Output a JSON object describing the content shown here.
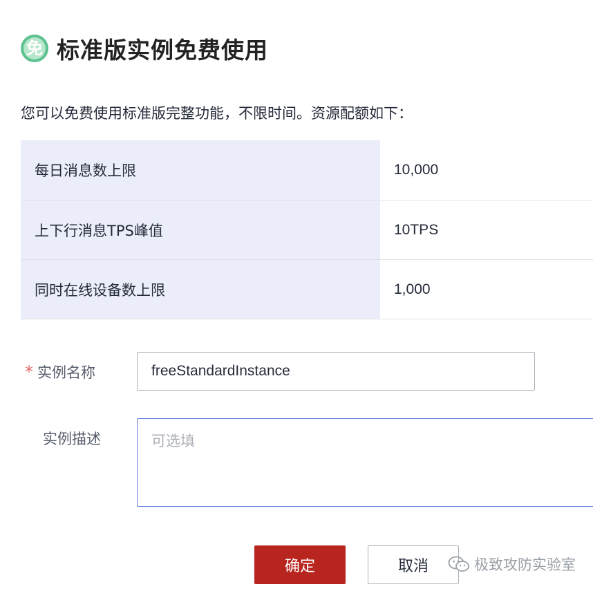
{
  "dialog": {
    "badge_text": "免",
    "title": "标准版实例免费使用",
    "intro": "您可以免费使用标准版完整功能，不限时间。资源配额如下："
  },
  "quota": [
    {
      "label": "每日消息数上限",
      "value": "10,000"
    },
    {
      "label": "上下行消息TPS峰值",
      "value": "10TPS"
    },
    {
      "label": "同时在线设备数上限",
      "value": "1,000"
    }
  ],
  "form": {
    "required_mark": "*",
    "name_label": "实例名称",
    "name_value": "freeStandardInstance",
    "desc_label": "实例描述",
    "desc_placeholder": "可选填"
  },
  "actions": {
    "confirm_label": "确定",
    "cancel_label": "取消"
  },
  "watermark": {
    "text": "极致攻防实验室",
    "icon": "wechat-icon"
  },
  "colors": {
    "primary_button": "#b8251f",
    "table_label_bg": "#ebeefa",
    "focus_border": "#5e7ce0",
    "badge": "#5cc08f",
    "required": "#e36d6d"
  }
}
